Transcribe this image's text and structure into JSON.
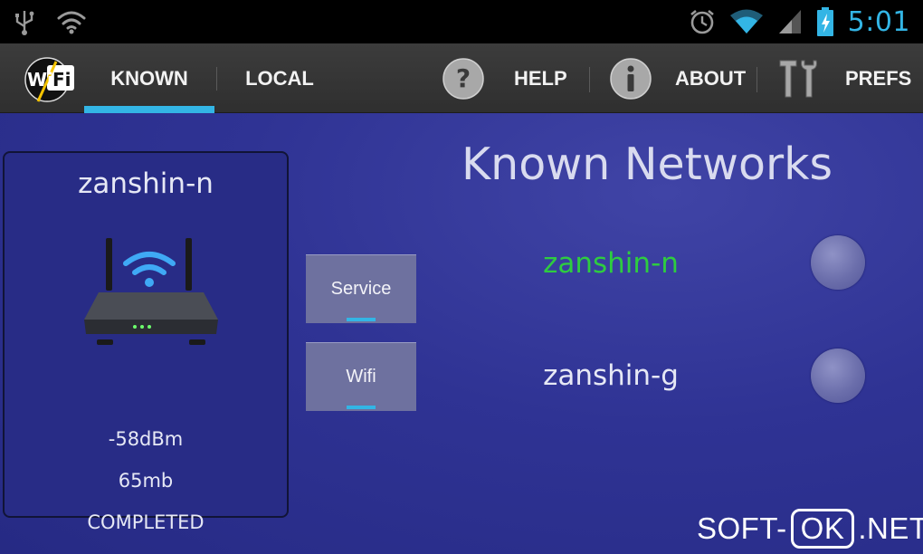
{
  "status_bar": {
    "clock": "5:01",
    "icons": [
      "usb-icon",
      "wifi-notification-icon",
      "alarm-icon",
      "wifi-signal-icon",
      "cell-signal-icon",
      "battery-charging-icon"
    ],
    "accent_color": "#33b5e5"
  },
  "action_bar": {
    "app_icon": "wifi-app-icon",
    "app_icon_text": "WiFi",
    "tabs": [
      {
        "label": "KNOWN",
        "selected": true
      },
      {
        "label": "LOCAL",
        "selected": false
      }
    ],
    "actions": [
      {
        "label": "HELP",
        "icon": "help-icon"
      },
      {
        "label": "ABOUT",
        "icon": "info-icon"
      },
      {
        "label": "PREFS",
        "icon": "tools-icon"
      }
    ]
  },
  "current_network": {
    "ssid": "zanshin-n",
    "signal": "-58dBm",
    "speed": "65mb",
    "state": "COMPLETED",
    "icon": "router-icon"
  },
  "side_buttons": [
    {
      "label": "Service"
    },
    {
      "label": "Wifi"
    }
  ],
  "known_networks": {
    "title": "Known Networks",
    "items": [
      {
        "ssid": "zanshin-n",
        "connected": true,
        "color": "#2ecc40"
      },
      {
        "ssid": "zanshin-g",
        "connected": false,
        "color": "#e6e8f5"
      }
    ]
  },
  "watermark": {
    "prefix": "SOFT-",
    "boxed": "OK",
    "suffix": ".NET"
  }
}
